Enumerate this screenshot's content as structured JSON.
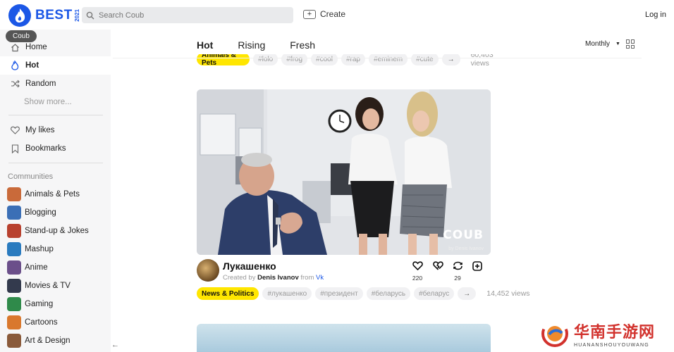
{
  "header": {
    "logo_text": "BEST",
    "logo_year": "2021",
    "search_placeholder": "Search Coub",
    "create_label": "Create",
    "login_label": "Log in"
  },
  "sidebar": {
    "tooltip": "Coub",
    "nav": [
      {
        "label": "Home",
        "icon": "home-icon"
      },
      {
        "label": "Hot",
        "icon": "flame-icon",
        "active": true
      },
      {
        "label": "Random",
        "icon": "shuffle-icon"
      },
      {
        "label": "Show more..."
      }
    ],
    "personal": [
      {
        "label": "My likes",
        "icon": "heart-icon"
      },
      {
        "label": "Bookmarks",
        "icon": "bookmark-icon"
      }
    ],
    "communities_title": "Communities",
    "communities": [
      {
        "label": "Animals & Pets",
        "color": "#c96a3a"
      },
      {
        "label": "Blogging",
        "color": "#3b6fb6"
      },
      {
        "label": "Stand-up & Jokes",
        "color": "#b8412f"
      },
      {
        "label": "Mashup",
        "color": "#2a7bbf"
      },
      {
        "label": "Anime",
        "color": "#6b4f8a"
      },
      {
        "label": "Movies & TV",
        "color": "#333a4d"
      },
      {
        "label": "Gaming",
        "color": "#2f8a4a"
      },
      {
        "label": "Cartoons",
        "color": "#d9782d"
      },
      {
        "label": "Art & Design",
        "color": "#8a5a3a"
      }
    ]
  },
  "main": {
    "tabs": [
      {
        "label": "Hot",
        "active": true
      },
      {
        "label": "Rising"
      },
      {
        "label": "Fresh"
      }
    ],
    "sort_label": "Monthly",
    "prev_post": {
      "category": "Animals & Pets",
      "tags": [
        "#lolo",
        "#frog",
        "#cool",
        "#rap",
        "#eminem",
        "#cute"
      ],
      "more": "→",
      "views": "60,403 views"
    },
    "post": {
      "watermark": "COUB",
      "watermark_credit": "by Denis Ivanov",
      "title": "Лукашенко",
      "created_by_prefix": "Created by",
      "author": "Denis Ivanov",
      "from_word": "from",
      "source": "Vk",
      "likes": "220",
      "recoubs": "29",
      "category": "News & Politics",
      "tags": [
        "#лукашенко",
        "#президент",
        "#беларусь",
        "#беларус"
      ],
      "more": "→",
      "views": "14,452 views"
    }
  },
  "site_watermark": {
    "cn": "华南手游网",
    "en": "HUANANSHOUYOUWANG"
  },
  "colors": {
    "brand": "#1b57e6",
    "category_tag": "#ffe600",
    "watermark_red": "#d2322d"
  }
}
